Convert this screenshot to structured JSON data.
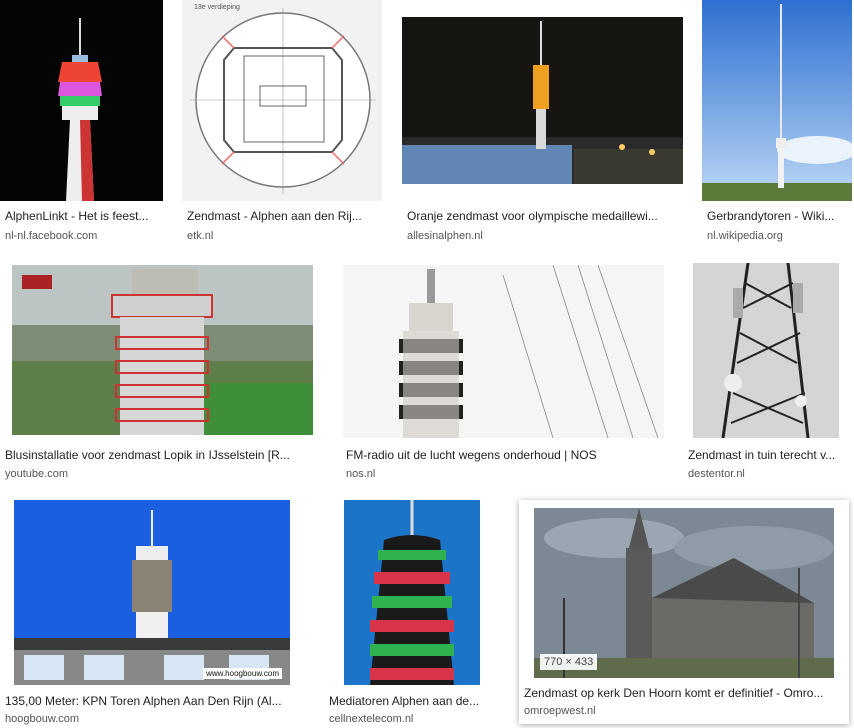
{
  "results": [
    {
      "title": "AlphenLinkt - Het is feest...",
      "source": "nl-nl.facebook.com",
      "icon": "tower-lights-image"
    },
    {
      "title": "Zendmast - Alphen aan den Rij...",
      "source": "etk.nl",
      "icon": "floorplan-image",
      "caption": "13e verdieping"
    },
    {
      "title": "Oranje zendmast voor olympische medaillewi...",
      "source": "allesinalphen.nl",
      "icon": "orange-tower-image"
    },
    {
      "title": "Gerbrandytoren - Wiki...",
      "source": "nl.wikipedia.org",
      "icon": "tall-mast-image"
    },
    {
      "title": "Blusinstallatie voor zendmast Lopik in IJsselstein [R...",
      "source": "youtube.com",
      "icon": "aerial-tower-image"
    },
    {
      "title": "FM-radio uit de lucht wegens onderhoud | NOS",
      "source": "nos.nl",
      "icon": "tower-top-image"
    },
    {
      "title": "Zendmast in tuin terecht v...",
      "source": "destentor.nl",
      "icon": "lattice-mast-image"
    },
    {
      "title": "135,00 Meter: KPN Toren Alphen Aan Den Rijn (Al...",
      "source": "hoogbouw.com",
      "icon": "blue-sky-tower-image",
      "watermark": "www.hoogbouw.com"
    },
    {
      "title": "Mediatoren Alphen aan de...",
      "source": "cellnextelecom.nl",
      "icon": "green-red-tower-image"
    },
    {
      "title": "Zendmast op kerk Den Hoorn komt er definitief - Omro...",
      "source": "omroepwest.nl",
      "icon": "church-image",
      "dims": "770 × 433"
    }
  ]
}
